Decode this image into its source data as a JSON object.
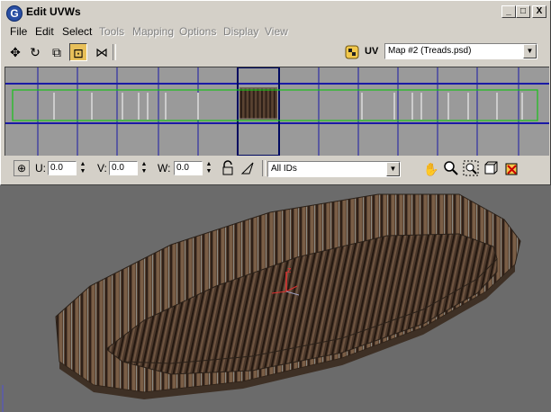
{
  "window": {
    "title": "Edit UVWs",
    "app_icon_letter": "G",
    "caption_buttons": [
      "_",
      "□",
      "X"
    ]
  },
  "menu": {
    "items": [
      {
        "label": "File",
        "enabled": true
      },
      {
        "label": "Edit",
        "enabled": true
      },
      {
        "label": "Select",
        "enabled": true
      },
      {
        "label": "Tools",
        "enabled": false
      },
      {
        "label": "Mapping",
        "enabled": false
      },
      {
        "label": "Options",
        "enabled": false
      },
      {
        "label": "Display",
        "enabled": false
      },
      {
        "label": "View",
        "enabled": false
      }
    ]
  },
  "toolbar": {
    "tools": [
      {
        "name": "move-tool",
        "icon": "move-icon",
        "glyph": "✥",
        "pressed": false
      },
      {
        "name": "rotate-tool",
        "icon": "rotate-icon",
        "glyph": "↻",
        "pressed": false
      },
      {
        "name": "scale-tool",
        "icon": "scale-icon",
        "glyph": "⧉",
        "pressed": false
      },
      {
        "name": "freeform-tool",
        "icon": "freeform-icon",
        "glyph": "⊡",
        "pressed": true
      },
      {
        "name": "mirror-tool",
        "icon": "mirror-icon",
        "glyph": "⋈",
        "pressed": false
      }
    ],
    "uv_label": "UV",
    "map_select": "Map #2 (Treads.psd)"
  },
  "uv_bar": {
    "u_label": "U:",
    "u_value": "0.0",
    "v_label": "V:",
    "v_value": "0.0",
    "w_label": "W:",
    "w_value": "0.0",
    "ids_select": "All IDs",
    "nav_icons": [
      "pan-icon",
      "zoom-icon",
      "zoom-region-icon",
      "zoom-extents-icon",
      "texture-toggle-icon"
    ]
  },
  "viewport": {
    "axis_label": "z",
    "accent_colors": {
      "uv_grid": "#1a1aa6",
      "uv_outline": "#19c219",
      "texture": "#5a4332",
      "gizmo_z": "#e03030"
    }
  }
}
